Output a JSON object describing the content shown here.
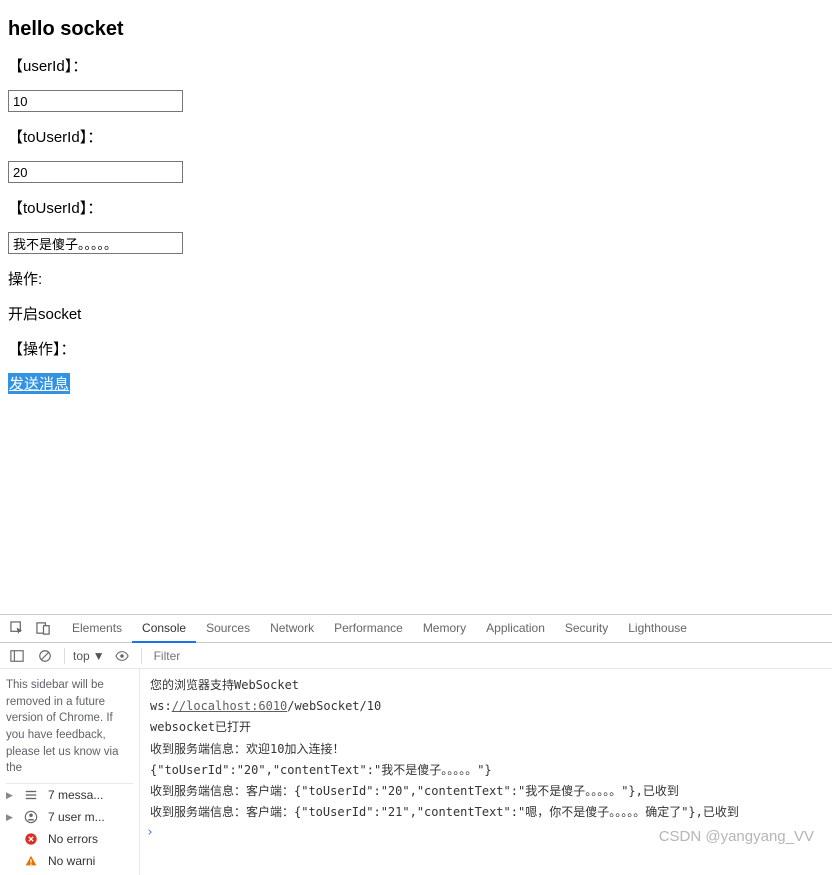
{
  "heading": "hello socket",
  "fields": {
    "userId": {
      "label": "【userId】：",
      "value": "10"
    },
    "toUserId": {
      "label": "【toUserId】：",
      "value": "20"
    },
    "content": {
      "label": "【toUserId】：",
      "value": "我不是傻子。。。。。"
    }
  },
  "action1": {
    "label": "操作:",
    "linkText": "开启socket"
  },
  "action2": {
    "label": "【操作】：",
    "linkText": "发送消息"
  },
  "devtools": {
    "tabs": [
      "Elements",
      "Console",
      "Sources",
      "Network",
      "Performance",
      "Memory",
      "Application",
      "Security",
      "Lighthouse"
    ],
    "activeTab": "Console",
    "contextDropdown": "top",
    "filterPlaceholder": "Filter",
    "sidebarMessage": "This sidebar will be removed in a future version of Chrome. If you have feedback, please let us know via the",
    "sidebarItems": [
      {
        "icon": "list",
        "text": "7 messa...",
        "expandable": true
      },
      {
        "icon": "user",
        "text": "7 user m...",
        "expandable": true
      },
      {
        "icon": "error",
        "text": "No errors",
        "expandable": false
      },
      {
        "icon": "warning",
        "text": "No warni",
        "expandable": false
      }
    ],
    "logs": [
      "您的浏览器支持WebSocket",
      {
        "prefix": "ws:",
        "url": "//localhost:6010",
        "suffix": "/webSocket/10"
      },
      "websocket已打开",
      "收到服务端信息：欢迎10加入连接！",
      "{\"toUserId\":\"20\",\"contentText\":\"我不是傻子。。。。。\"}",
      "收到服务端信息：客户端：{\"toUserId\":\"20\",\"contentText\":\"我不是傻子。。。。。\"},已收到",
      "收到服务端信息：客户端：{\"toUserId\":\"21\",\"contentText\":\"嗯，你不是傻子。。。。。确定了\"},已收到"
    ]
  },
  "watermark": "CSDN @yangyang_VV"
}
